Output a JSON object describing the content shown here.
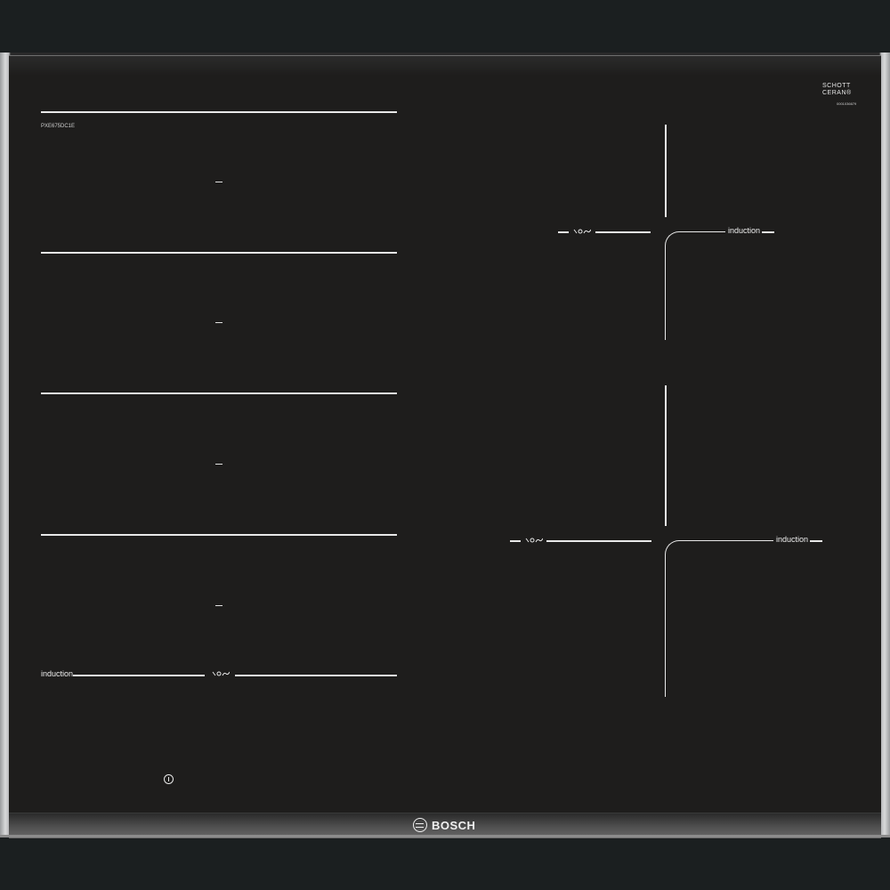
{
  "product": {
    "brand": "BOSCH",
    "model_number": "PXE675DC1E",
    "glass_maker": [
      "SCHOTT",
      "CERAN®"
    ],
    "glass_serial": "0001036679"
  },
  "cooktop_labels": {
    "left_bottom_zone_label": "induction",
    "right_top_zone_label": "induction",
    "right_bottom_zone_label": "induction"
  },
  "icons": {
    "flex_zone_symbol": "flex-induction-icon",
    "power_button": "power-icon",
    "brand_logo": "bosch-logo-icon"
  },
  "colors": {
    "glass": "#1e1d1c",
    "frame_steel": "#c9cacb",
    "markings": "#e8e8e8",
    "background": "#1b1f20"
  }
}
